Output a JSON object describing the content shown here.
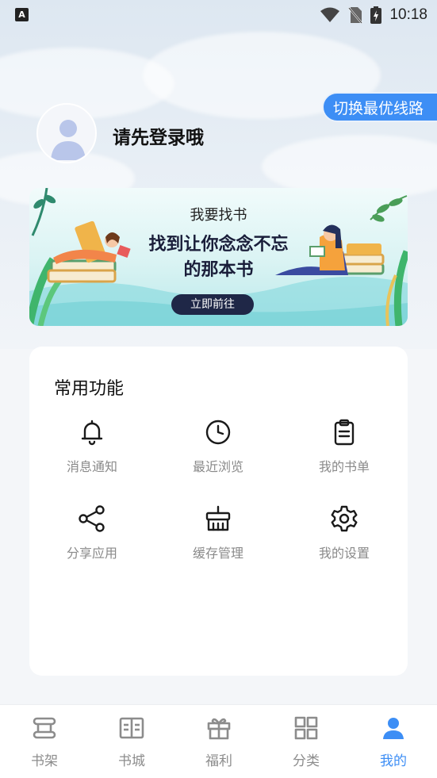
{
  "status_bar": {
    "time": "10:18"
  },
  "header": {
    "switch_route_label": "切换最优线路",
    "login_prompt": "请先登录哦"
  },
  "banner": {
    "subtitle": "我要找书",
    "title_line1": "找到让你念念不忘",
    "title_line2": "的那本书",
    "button_label": "立即前往"
  },
  "functions": {
    "title": "常用功能",
    "items": [
      {
        "label": "消息通知",
        "icon": "bell-icon"
      },
      {
        "label": "最近浏览",
        "icon": "clock-icon"
      },
      {
        "label": "我的书单",
        "icon": "clipboard-icon"
      },
      {
        "label": "分享应用",
        "icon": "share-icon"
      },
      {
        "label": "缓存管理",
        "icon": "basket-icon"
      },
      {
        "label": "我的设置",
        "icon": "gear-icon"
      }
    ]
  },
  "tabbar": {
    "active_color": "#3d8ef5",
    "items": [
      {
        "label": "书架",
        "icon": "bookshelf-icon"
      },
      {
        "label": "书城",
        "icon": "open-book-icon"
      },
      {
        "label": "福利",
        "icon": "gift-icon"
      },
      {
        "label": "分类",
        "icon": "grid-icon"
      },
      {
        "label": "我的",
        "icon": "user-icon",
        "active": true
      }
    ]
  }
}
